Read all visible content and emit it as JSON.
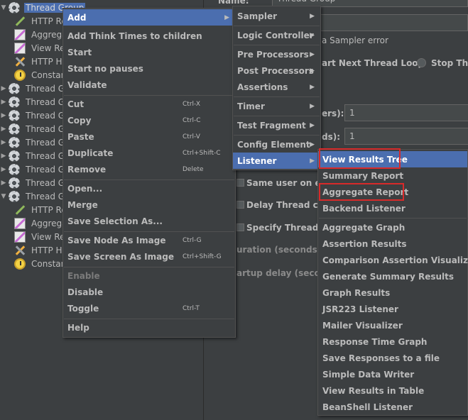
{
  "tree": {
    "items": [
      {
        "label": "Thread Group",
        "icon": "gear-icon",
        "toggle": "▼",
        "selected": true
      },
      {
        "label": "HTTP Re",
        "icon": "pipette-icon"
      },
      {
        "label": "Aggrega",
        "icon": "graph-icon"
      },
      {
        "label": "View Re",
        "icon": "graph-icon"
      },
      {
        "label": "HTTP He",
        "icon": "tools-icon"
      },
      {
        "label": "Constan",
        "icon": "timer-icon"
      },
      {
        "label": "Thread Gr",
        "icon": "gear-icon",
        "toggle": "▶"
      },
      {
        "label": "Thread Gr",
        "icon": "gear-icon",
        "toggle": "▶"
      },
      {
        "label": "Thread Gr",
        "icon": "gear-icon",
        "toggle": "▶"
      },
      {
        "label": "Thread Gr",
        "icon": "gear-icon",
        "toggle": "▶"
      },
      {
        "label": "Thread Gr",
        "icon": "gear-icon",
        "toggle": "▶"
      },
      {
        "label": "Thread Gr",
        "icon": "gear-icon",
        "toggle": "▶"
      },
      {
        "label": "Thread Gr",
        "icon": "gear-icon",
        "toggle": "▶"
      },
      {
        "label": "Thread Gr",
        "icon": "gear-icon",
        "toggle": "▶"
      },
      {
        "label": "Thread Gr",
        "icon": "gear-icon",
        "toggle": "▼"
      },
      {
        "label": "HTTP Re",
        "icon": "pipette-icon"
      },
      {
        "label": "Aggrega",
        "icon": "graph-icon"
      },
      {
        "label": "View Re",
        "icon": "graph-icon"
      },
      {
        "label": "HTTP He",
        "icon": "tools-icon"
      },
      {
        "label": "Constan",
        "icon": "timer-icon"
      }
    ]
  },
  "panel": {
    "name_label": "Name:",
    "name_value": "Thread Group",
    "sampler_error": "a Sampler error",
    "next_loop": "art Next Thread Loop",
    "stop_thread": "Stop Thre",
    "threads_label": "ers):",
    "threads_value": "1",
    "rampup_label": "ds):",
    "rampup_value": "1",
    "same_user": "Same user on eac",
    "delay_thread": "Delay Thread crea",
    "specify_lifetime": "Specify Thread life",
    "duration": "uration (seconds):",
    "startup_delay": "artup delay (seconds"
  },
  "menu_main": {
    "items": [
      {
        "label": "Add",
        "arrow": "▶",
        "highlight": true
      },
      {
        "label": "Add Think Times to children"
      },
      {
        "label": "Start"
      },
      {
        "label": "Start no pauses"
      },
      {
        "label": "Validate"
      },
      {
        "label": "Cut",
        "shortcut": "Ctrl-X"
      },
      {
        "label": "Copy",
        "shortcut": "Ctrl-C"
      },
      {
        "label": "Paste",
        "shortcut": "Ctrl-V"
      },
      {
        "label": "Duplicate",
        "shortcut": "Ctrl+Shift-C"
      },
      {
        "label": "Remove",
        "shortcut": "Delete"
      },
      {
        "label": "Open..."
      },
      {
        "label": "Merge"
      },
      {
        "label": "Save Selection As..."
      },
      {
        "label": "Save Node As Image",
        "shortcut": "Ctrl-G"
      },
      {
        "label": "Save Screen As Image",
        "shortcut": "Ctrl+Shift-G"
      },
      {
        "label": "Enable",
        "disabled": true
      },
      {
        "label": "Disable"
      },
      {
        "label": "Toggle",
        "shortcut": "Ctrl-T"
      },
      {
        "label": "Help"
      }
    ]
  },
  "menu_add": {
    "items": [
      {
        "label": "Sampler",
        "arrow": "▶"
      },
      {
        "label": "Logic Controller",
        "arrow": "▶"
      },
      {
        "label": "Pre Processors",
        "arrow": "▶"
      },
      {
        "label": "Post Processors",
        "arrow": "▶"
      },
      {
        "label": "Assertions",
        "arrow": "▶"
      },
      {
        "label": "Timer",
        "arrow": "▶"
      },
      {
        "label": "Test Fragment",
        "arrow": "▶"
      },
      {
        "label": "Config Element",
        "arrow": "▶"
      },
      {
        "label": "Listener",
        "arrow": "▶",
        "highlight": true
      }
    ]
  },
  "menu_listener": {
    "items": [
      {
        "label": "View Results Tree",
        "highlight": true,
        "outlined": true
      },
      {
        "label": "Summary Report"
      },
      {
        "label": "Aggregate Report",
        "outlined": true
      },
      {
        "label": "Backend Listener"
      },
      {
        "label": "Aggregate Graph"
      },
      {
        "label": "Assertion Results"
      },
      {
        "label": "Comparison Assertion Visualizer"
      },
      {
        "label": "Generate Summary Results"
      },
      {
        "label": "Graph Results"
      },
      {
        "label": "JSR223 Listener"
      },
      {
        "label": "Mailer Visualizer"
      },
      {
        "label": "Response Time Graph"
      },
      {
        "label": "Save Responses to a file"
      },
      {
        "label": "Simple Data Writer"
      },
      {
        "label": "View Results in Table"
      },
      {
        "label": "BeanShell Listener"
      }
    ]
  },
  "colors": {
    "background": "#3c3f41",
    "highlight": "#4b6eaf",
    "outline": "#d82a2a"
  }
}
